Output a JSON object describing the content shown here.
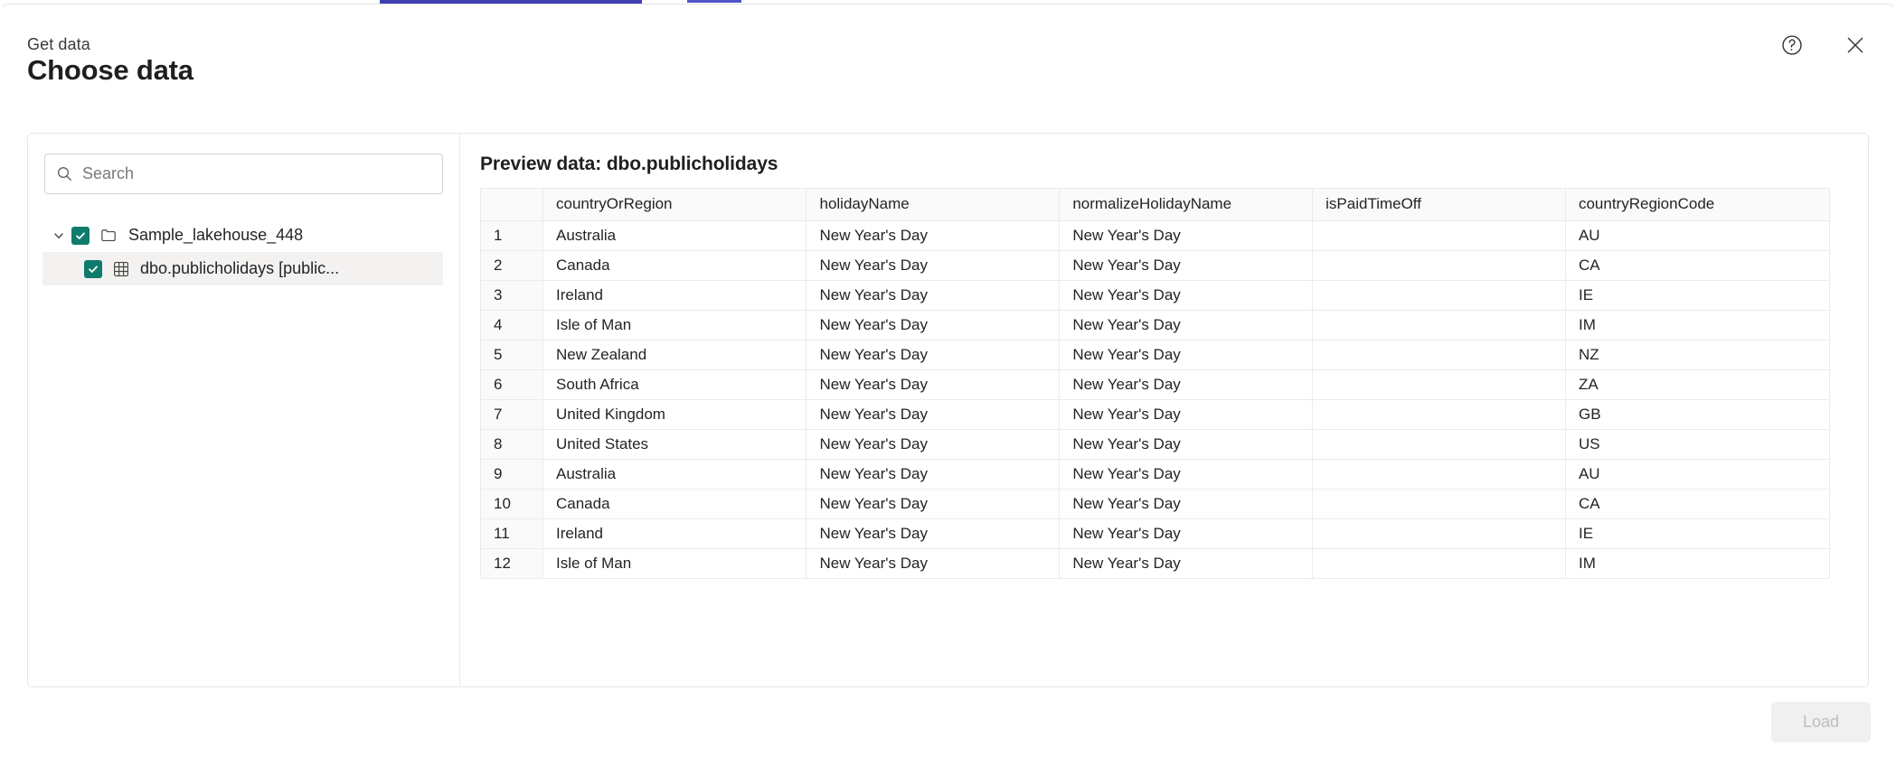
{
  "header": {
    "eyebrow": "Get data",
    "title": "Choose data",
    "help_icon": "help-circle-icon",
    "close_icon": "close-icon"
  },
  "left_panel": {
    "search": {
      "placeholder": "Search",
      "value": "",
      "icon": "search-icon"
    },
    "tree": [
      {
        "label": "Sample_lakehouse_448",
        "icon": "folder-icon",
        "chevron": "chevron-down-icon",
        "checked": true,
        "selected": false,
        "level": 0
      },
      {
        "label": "dbo.publicholidays [public...",
        "icon": "table-grid-icon",
        "checked": true,
        "selected": true,
        "level": 1
      }
    ]
  },
  "preview": {
    "title": "Preview data: dbo.publicholidays",
    "columns": [
      "countryOrRegion",
      "holidayName",
      "normalizeHolidayName",
      "isPaidTimeOff",
      "countryRegionCode"
    ],
    "rows": [
      {
        "n": "1",
        "countryOrRegion": "Australia",
        "holidayName": "New Year's Day",
        "normalizeHolidayName": "New Year's Day",
        "isPaidTimeOff": "",
        "countryRegionCode": "AU"
      },
      {
        "n": "2",
        "countryOrRegion": "Canada",
        "holidayName": "New Year's Day",
        "normalizeHolidayName": "New Year's Day",
        "isPaidTimeOff": "",
        "countryRegionCode": "CA"
      },
      {
        "n": "3",
        "countryOrRegion": "Ireland",
        "holidayName": "New Year's Day",
        "normalizeHolidayName": "New Year's Day",
        "isPaidTimeOff": "",
        "countryRegionCode": "IE"
      },
      {
        "n": "4",
        "countryOrRegion": "Isle of Man",
        "holidayName": "New Year's Day",
        "normalizeHolidayName": "New Year's Day",
        "isPaidTimeOff": "",
        "countryRegionCode": "IM"
      },
      {
        "n": "5",
        "countryOrRegion": "New Zealand",
        "holidayName": "New Year's Day",
        "normalizeHolidayName": "New Year's Day",
        "isPaidTimeOff": "",
        "countryRegionCode": "NZ"
      },
      {
        "n": "6",
        "countryOrRegion": "South Africa",
        "holidayName": "New Year's Day",
        "normalizeHolidayName": "New Year's Day",
        "isPaidTimeOff": "",
        "countryRegionCode": "ZA"
      },
      {
        "n": "7",
        "countryOrRegion": "United Kingdom",
        "holidayName": "New Year's Day",
        "normalizeHolidayName": "New Year's Day",
        "isPaidTimeOff": "",
        "countryRegionCode": "GB"
      },
      {
        "n": "8",
        "countryOrRegion": "United States",
        "holidayName": "New Year's Day",
        "normalizeHolidayName": "New Year's Day",
        "isPaidTimeOff": "",
        "countryRegionCode": "US"
      },
      {
        "n": "9",
        "countryOrRegion": "Australia",
        "holidayName": "New Year's Day",
        "normalizeHolidayName": "New Year's Day",
        "isPaidTimeOff": "",
        "countryRegionCode": "AU"
      },
      {
        "n": "10",
        "countryOrRegion": "Canada",
        "holidayName": "New Year's Day",
        "normalizeHolidayName": "New Year's Day",
        "isPaidTimeOff": "",
        "countryRegionCode": "CA"
      },
      {
        "n": "11",
        "countryOrRegion": "Ireland",
        "holidayName": "New Year's Day",
        "normalizeHolidayName": "New Year's Day",
        "isPaidTimeOff": "",
        "countryRegionCode": "IE"
      },
      {
        "n": "12",
        "countryOrRegion": "Isle of Man",
        "holidayName": "New Year's Day",
        "normalizeHolidayName": "New Year's Day",
        "isPaidTimeOff": "",
        "countryRegionCode": "IM"
      }
    ]
  },
  "footer": {
    "load_label": "Load",
    "load_disabled": true
  },
  "colors": {
    "checkbox_green": "#0f7b6c",
    "dialog_background": "#ffffff",
    "border": "#e6e6e6",
    "header_row_background": "#fafafa",
    "selected_row_background": "#f3f2f1",
    "disabled_button_background": "#f0f0f0",
    "disabled_button_text": "#bdbdbd"
  }
}
